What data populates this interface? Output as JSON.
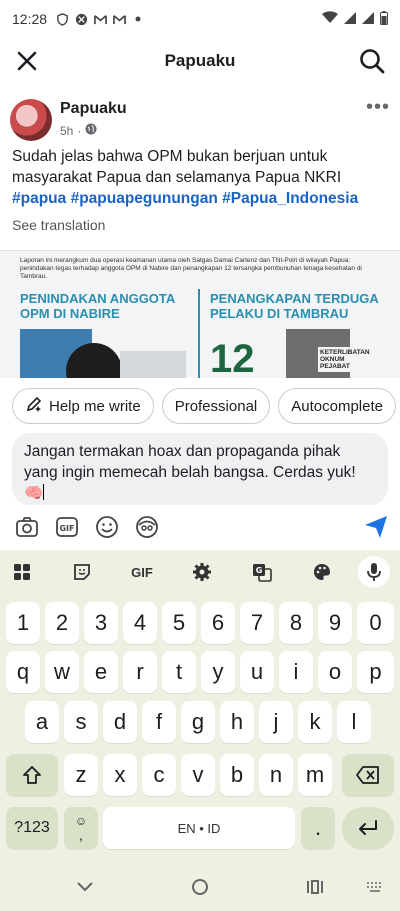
{
  "status_bar": {
    "time": "12:28"
  },
  "header": {
    "title": "Papuaku"
  },
  "post": {
    "author": "Papuaku",
    "time": "5h",
    "text": "Sudah jelas bahwa OPM bukan berjuan untuk masyarakat Papua dan selamanya Papua NKRI",
    "hashtags": "#papua #papuapegunungan #Papua_Indonesia",
    "see_translation": "See translation",
    "image": {
      "caption": "Laporan ini merangkum dua operasi keamanan utama oleh Satgas Damai Cartenz dan TNI-Polri di wilayah Papua: penindakan tegas terhadap anggota OPM di Nabire dan penangkapan 12 tersangka pembunuhan tenaga kesehatan di Tambrau.",
      "heading_left": "PENINDAKAN ANGGOTA OPM DI NABIRE",
      "heading_right": "PENANGKAPAN TERDUGA PELAKU DI TAMBRAU",
      "number": "12",
      "tag": "KETERLIBATAN OKNUM PEJABAT"
    }
  },
  "chips": [
    "Help me write",
    "Professional",
    "Autocomplete"
  ],
  "comment": {
    "text": "Jangan termakan hoax dan propaganda pihak yang ingin memecah belah bangsa. Cerdas yuk! 🧠"
  },
  "keyboard": {
    "gif_label": "GIF",
    "row_numbers": [
      "1",
      "2",
      "3",
      "4",
      "5",
      "6",
      "7",
      "8",
      "9",
      "0"
    ],
    "row_1": [
      "q",
      "w",
      "e",
      "r",
      "t",
      "y",
      "u",
      "i",
      "o",
      "p"
    ],
    "row_2": [
      "a",
      "s",
      "d",
      "f",
      "g",
      "h",
      "j",
      "k",
      "l"
    ],
    "row_3": [
      "z",
      "x",
      "c",
      "v",
      "b",
      "n",
      "m"
    ],
    "symbols_label": "?123",
    "comma": ",",
    "space_label": "EN • ID",
    "period": "."
  },
  "colors": {
    "accent": "#1b63c6",
    "keyboard_bg": "#eef1e1",
    "func_key": "#d9e2c8"
  }
}
